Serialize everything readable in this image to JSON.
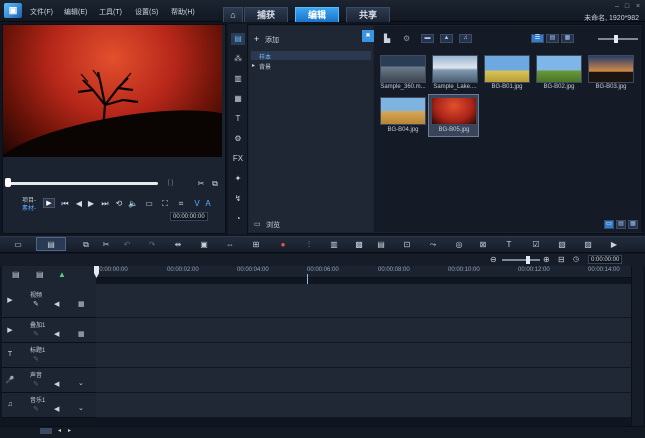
{
  "menu": {
    "items": [
      "文件(F)",
      "编辑(E)",
      "工具(T)",
      "设置(S)",
      "帮助(H)"
    ]
  },
  "tabs": {
    "home_icon": "home-icon",
    "capture": "捕获",
    "edit": "编辑",
    "share": "共享",
    "active": "edit"
  },
  "project": {
    "info": "未命名, 1920*982"
  },
  "preview": {
    "project_label": "项目-",
    "clip_label": "素材-",
    "timecode": "00:00:00:00",
    "brackets": "[ ]",
    "position": 0
  },
  "library": {
    "add_label": "添加",
    "browse_label": "浏览",
    "tree": [
      {
        "label": "样本",
        "selected": true
      },
      {
        "label": "背景",
        "selected": false,
        "expandable": true
      }
    ],
    "media": [
      {
        "name": "Sample_360.m...",
        "selected": false
      },
      {
        "name": "Sample_Lake....",
        "selected": false
      },
      {
        "name": "BG-B01.jpg",
        "selected": false
      },
      {
        "name": "BG-B02.jpg",
        "selected": false
      },
      {
        "name": "BG-B03.jpg",
        "selected": false
      },
      {
        "name": "BG-B04.jpg",
        "selected": false
      },
      {
        "name": "BG-B05.jpg",
        "selected": true
      }
    ]
  },
  "timeline": {
    "timecode": "0:00:00:00",
    "ruler": [
      "00:00:00:00",
      "00:00:02:00",
      "00:00:04:00",
      "00:00:06:00",
      "00:00:08:00",
      "00:00:10:00",
      "00:00:12:00",
      "00:00:14:00"
    ],
    "tracks": [
      {
        "name": "视频",
        "icon": "video-track-icon"
      },
      {
        "name": "叠加1",
        "icon": "overlay-track-icon"
      },
      {
        "name": "标题1",
        "icon": "title-track-icon"
      },
      {
        "name": "声音",
        "icon": "voice-track-icon"
      },
      {
        "name": "音乐1",
        "icon": "music-track-icon"
      }
    ]
  },
  "colors": {
    "accent": "#2d8ee0",
    "background": "#101621",
    "panel": "#1b2230"
  }
}
